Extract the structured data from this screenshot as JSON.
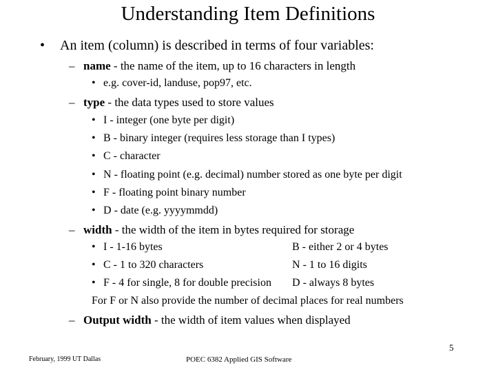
{
  "slide": {
    "title": "Understanding Item Definitions",
    "bullet_main": "An item (column) is described in terms of four variables:",
    "name": {
      "term": "name",
      "desc": " - the name of the item, up to 16 characters in length",
      "example": "e.g. cover-id, landuse, pop97, etc."
    },
    "type": {
      "term": "type",
      "desc": " - the data types used to store values",
      "items": [
        {
          "code": "I",
          "desc": " - integer (one byte per digit)"
        },
        {
          "code": "B",
          "desc": " - binary integer (requires less storage than I types)"
        },
        {
          "code": "C",
          "desc": " - character"
        },
        {
          "code": "N",
          "desc": " - floating point (e.g. decimal) number stored as one byte per digit"
        },
        {
          "code": "F",
          "desc": " - floating point binary number"
        },
        {
          "code": "D",
          "desc": " - date (e.g. yyyymmdd)"
        }
      ]
    },
    "width": {
      "term": "width",
      "desc": " - the width of the item in bytes required for storage",
      "rows": [
        {
          "left_code": "I",
          "left_desc": " - 1-16 bytes",
          "right_code": "B",
          "right_desc": " - either 2 or 4 bytes"
        },
        {
          "left_code": "C",
          "left_desc": " - 1 to 320 characters",
          "right_code": "N",
          "right_desc": " - 1 to 16 digits"
        },
        {
          "left_code": "F",
          "left_desc": " - 4 for single, 8 for double precision",
          "right_code": "D",
          "right_desc": " - always 8 bytes"
        }
      ],
      "note": "For F or N also provide the number of decimal places for real numbers"
    },
    "output_width": {
      "term": "Output width",
      "desc": " - the width of item values when displayed"
    },
    "bullet_char": "•",
    "dash_char": "–"
  },
  "footer": {
    "left": "February, 1999 UT Dallas",
    "center": "POEC 6382 Applied GIS Software",
    "page_number": "5"
  }
}
